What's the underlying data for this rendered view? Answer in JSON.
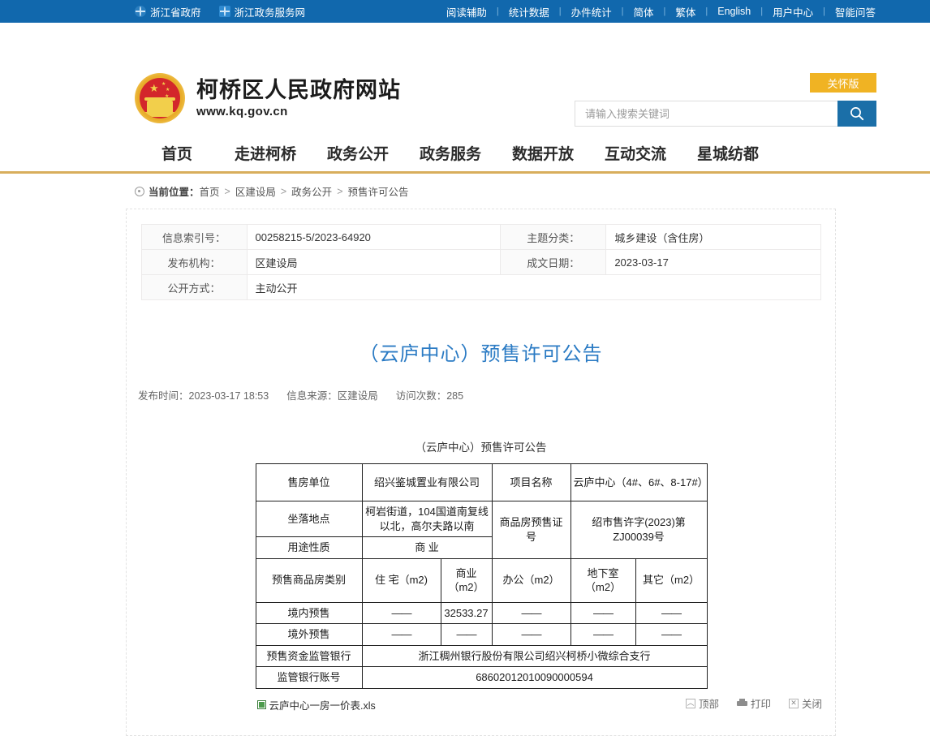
{
  "topbar": {
    "left_links": [
      {
        "label": "浙江省政府",
        "icon": "globe-icon",
        "boxed": false
      },
      {
        "label": "浙江政务服务网",
        "icon": "globe-icon",
        "boxed": true
      }
    ],
    "right_links": [
      "阅读辅助",
      "统计数据",
      "办件统计",
      "简体",
      "繁体",
      "English",
      "用户中心",
      "智能问答"
    ],
    "separator": "|",
    "bg_color": "#1168ad"
  },
  "header": {
    "brand_title": "柯桥区人民政府网站",
    "brand_url": "www.kq.gov.cn",
    "emblem_icon": "national-emblem-icon",
    "care_button": "关怀版",
    "care_color": "#f0b323",
    "search": {
      "placeholder": "请输入搜索关键词",
      "value": "",
      "button_icon": "search-icon",
      "button_color": "#1b6fa8"
    }
  },
  "nav": {
    "items": [
      "首页",
      "走进柯桥",
      "政务公开",
      "政务服务",
      "数据开放",
      "互动交流",
      "星城纺都"
    ],
    "underline_color": "#d8ae5c"
  },
  "breadcrumb": {
    "icon": "location-icon",
    "label": "当前位置：",
    "items": [
      "首页",
      "区建设局",
      "政务公开",
      "预售许可公告"
    ],
    "separator": ">"
  },
  "info_table": {
    "rows": [
      {
        "label1": "信息索引号：",
        "value1": "00258215-5/2023-64920",
        "label2": "主题分类：",
        "value2": "城乡建设（含住房）"
      },
      {
        "label1": "发布机构：",
        "value1": "区建设局",
        "label2": "成文日期：",
        "value2": "2023-03-17"
      },
      {
        "label1": "公开方式：",
        "value1": "主动公开",
        "label2": "",
        "value2": ""
      }
    ]
  },
  "article": {
    "title": "（云庐中心）预售许可公告",
    "title_color": "#2b7bc4",
    "meta": [
      "发布时间：2023-03-17 18:53",
      "信息来源：区建设局",
      "访问次数：285"
    ]
  },
  "permit": {
    "heading": "（云庐中心）预售许可公告",
    "seller_label": "售房单位",
    "seller_value": "绍兴鉴城置业有限公司",
    "project_label": "项目名称",
    "project_value": "云庐中心（4#、6#、8-17#）",
    "location_label": "坐落地点",
    "location_value": "柯岩街道，104国道南复线以北，高尔夫路以南",
    "usage_label": "用途性质",
    "usage_value": "商 业",
    "cert_label": "商品房预售证号",
    "cert_value": "绍市售许字(2023)第ZJ00039号",
    "category_label": "预售商品房类别",
    "categories": [
      "住 宅（m2)",
      "商业（m2）",
      "办公（m2）",
      "地下室（m2）",
      "其它（m2）"
    ],
    "domestic_label": "境内预售",
    "domestic_values": [
      "——",
      "32533.27",
      "——",
      "——",
      "——"
    ],
    "overseas_label": "境外预售",
    "overseas_values": [
      "——",
      "——",
      "——",
      "——",
      "——"
    ],
    "bank_label": "预售资金监管银行",
    "bank_value": "浙江稠州银行股份有限公司绍兴柯桥小微综合支行",
    "account_label": "监管银行账号",
    "account_value": "68602012010090000594"
  },
  "attachment": {
    "icon": "xls-file-icon",
    "name": "云庐中心一房一价表.xls"
  },
  "footer_actions": [
    {
      "label": "顶部",
      "icon": "chevron-up-icon"
    },
    {
      "label": "打印",
      "icon": "printer-icon"
    },
    {
      "label": "关闭",
      "icon": "close-icon"
    }
  ]
}
